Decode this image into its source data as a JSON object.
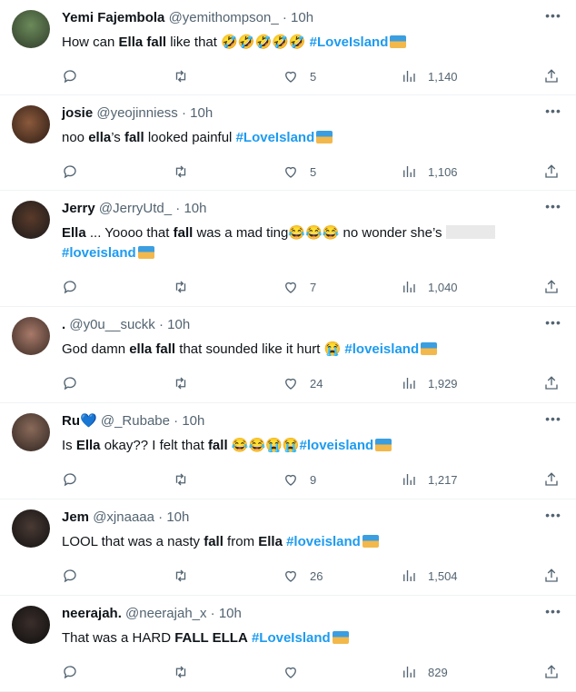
{
  "tweets": [
    {
      "name": "Yemi Fajembola",
      "handle": "@yemithompson_",
      "dot": "·",
      "time": "10h",
      "text_parts": [
        "How can ",
        "Ella",
        " ",
        "fall",
        " like that ",
        "🤣🤣🤣🤣🤣",
        " ",
        "#LoveIsland"
      ],
      "likes": "5",
      "views": "1,140"
    },
    {
      "name": "josie",
      "handle": "@yeojinniess",
      "dot": "·",
      "time": "10h",
      "text_parts": [
        "noo ",
        "ella",
        "’s ",
        "fall",
        " looked painful ",
        "#LoveIsland"
      ],
      "likes": "5",
      "views": "1,106"
    },
    {
      "name": "Jerry",
      "handle": "@JerryUtd_",
      "dot": "·",
      "time": "10h",
      "text_parts": [
        "Ella",
        " ... Yoooo that ",
        "fall",
        " was a mad ting",
        "😂😂😂",
        " no wonder she’s ",
        "#loveisland"
      ],
      "likes": "7",
      "views": "1,040"
    },
    {
      "name": ".",
      "handle": "@y0u__suckk",
      "dot": "·",
      "time": "10h",
      "text_parts": [
        "God damn ",
        "ella",
        " ",
        "fall",
        " that sounded like it hurt ",
        "😭",
        " ",
        "#loveisland"
      ],
      "likes": "24",
      "views": "1,929"
    },
    {
      "name": "Ru",
      "badge": "💙",
      "handle": "@_Rubabe",
      "dot": "·",
      "time": "10h",
      "text_parts": [
        "Is ",
        "Ella",
        " okay?? I felt that ",
        "fall",
        " ",
        "😂😂😭😭",
        "#loveisland"
      ],
      "likes": "9",
      "views": "1,217"
    },
    {
      "name": "Jem",
      "handle": "@xjnaaaa",
      "dot": "·",
      "time": "10h",
      "text_parts": [
        "LOOL that was a nasty ",
        "fall",
        " from ",
        "Ella",
        " ",
        "#loveisland"
      ],
      "likes": "26",
      "views": "1,504"
    },
    {
      "name": "neerajah.",
      "handle": "@neerajah_x",
      "dot": "·",
      "time": "10h",
      "text_parts": [
        "That was a HARD ",
        "FALL ELLA",
        " ",
        "#LoveIsland"
      ],
      "likes": "",
      "views": "829"
    }
  ],
  "icons": {
    "reply": "reply-icon",
    "retweet": "retweet-icon",
    "like": "heart-icon",
    "views": "views-icon",
    "share": "share-icon",
    "more": "more-icon",
    "flag": "love-island-emoji-icon"
  },
  "colors": {
    "accent": "#1d9bf0",
    "muted": "#536471",
    "text": "#0f1419",
    "divider": "#eff3f4"
  }
}
